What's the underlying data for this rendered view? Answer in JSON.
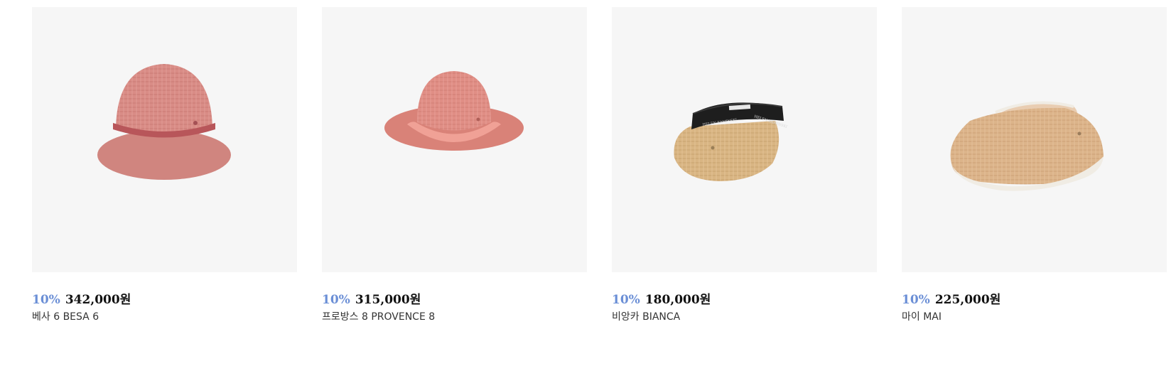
{
  "colors": {
    "discount": "#6b8fd6",
    "price": "#111111",
    "thumb_bg": "#f6f6f6"
  },
  "products": [
    {
      "discount": "10%",
      "price": "342,000원",
      "name": "베사 6 BESA 6",
      "image_icon": "pink-raffia-bucket-hat"
    },
    {
      "discount": "10%",
      "price": "315,000원",
      "name": "프로방스 8 PROVENCE 8",
      "image_icon": "pink-raffia-brim-hat"
    },
    {
      "discount": "10%",
      "price": "180,000원",
      "name": "비앙카 BIANCA",
      "image_icon": "natural-raffia-visor-black-band",
      "band_text": "HELEN KAMINSKI"
    },
    {
      "discount": "10%",
      "price": "225,000원",
      "name": "마이 MAI",
      "image_icon": "natural-raffia-visor"
    }
  ]
}
